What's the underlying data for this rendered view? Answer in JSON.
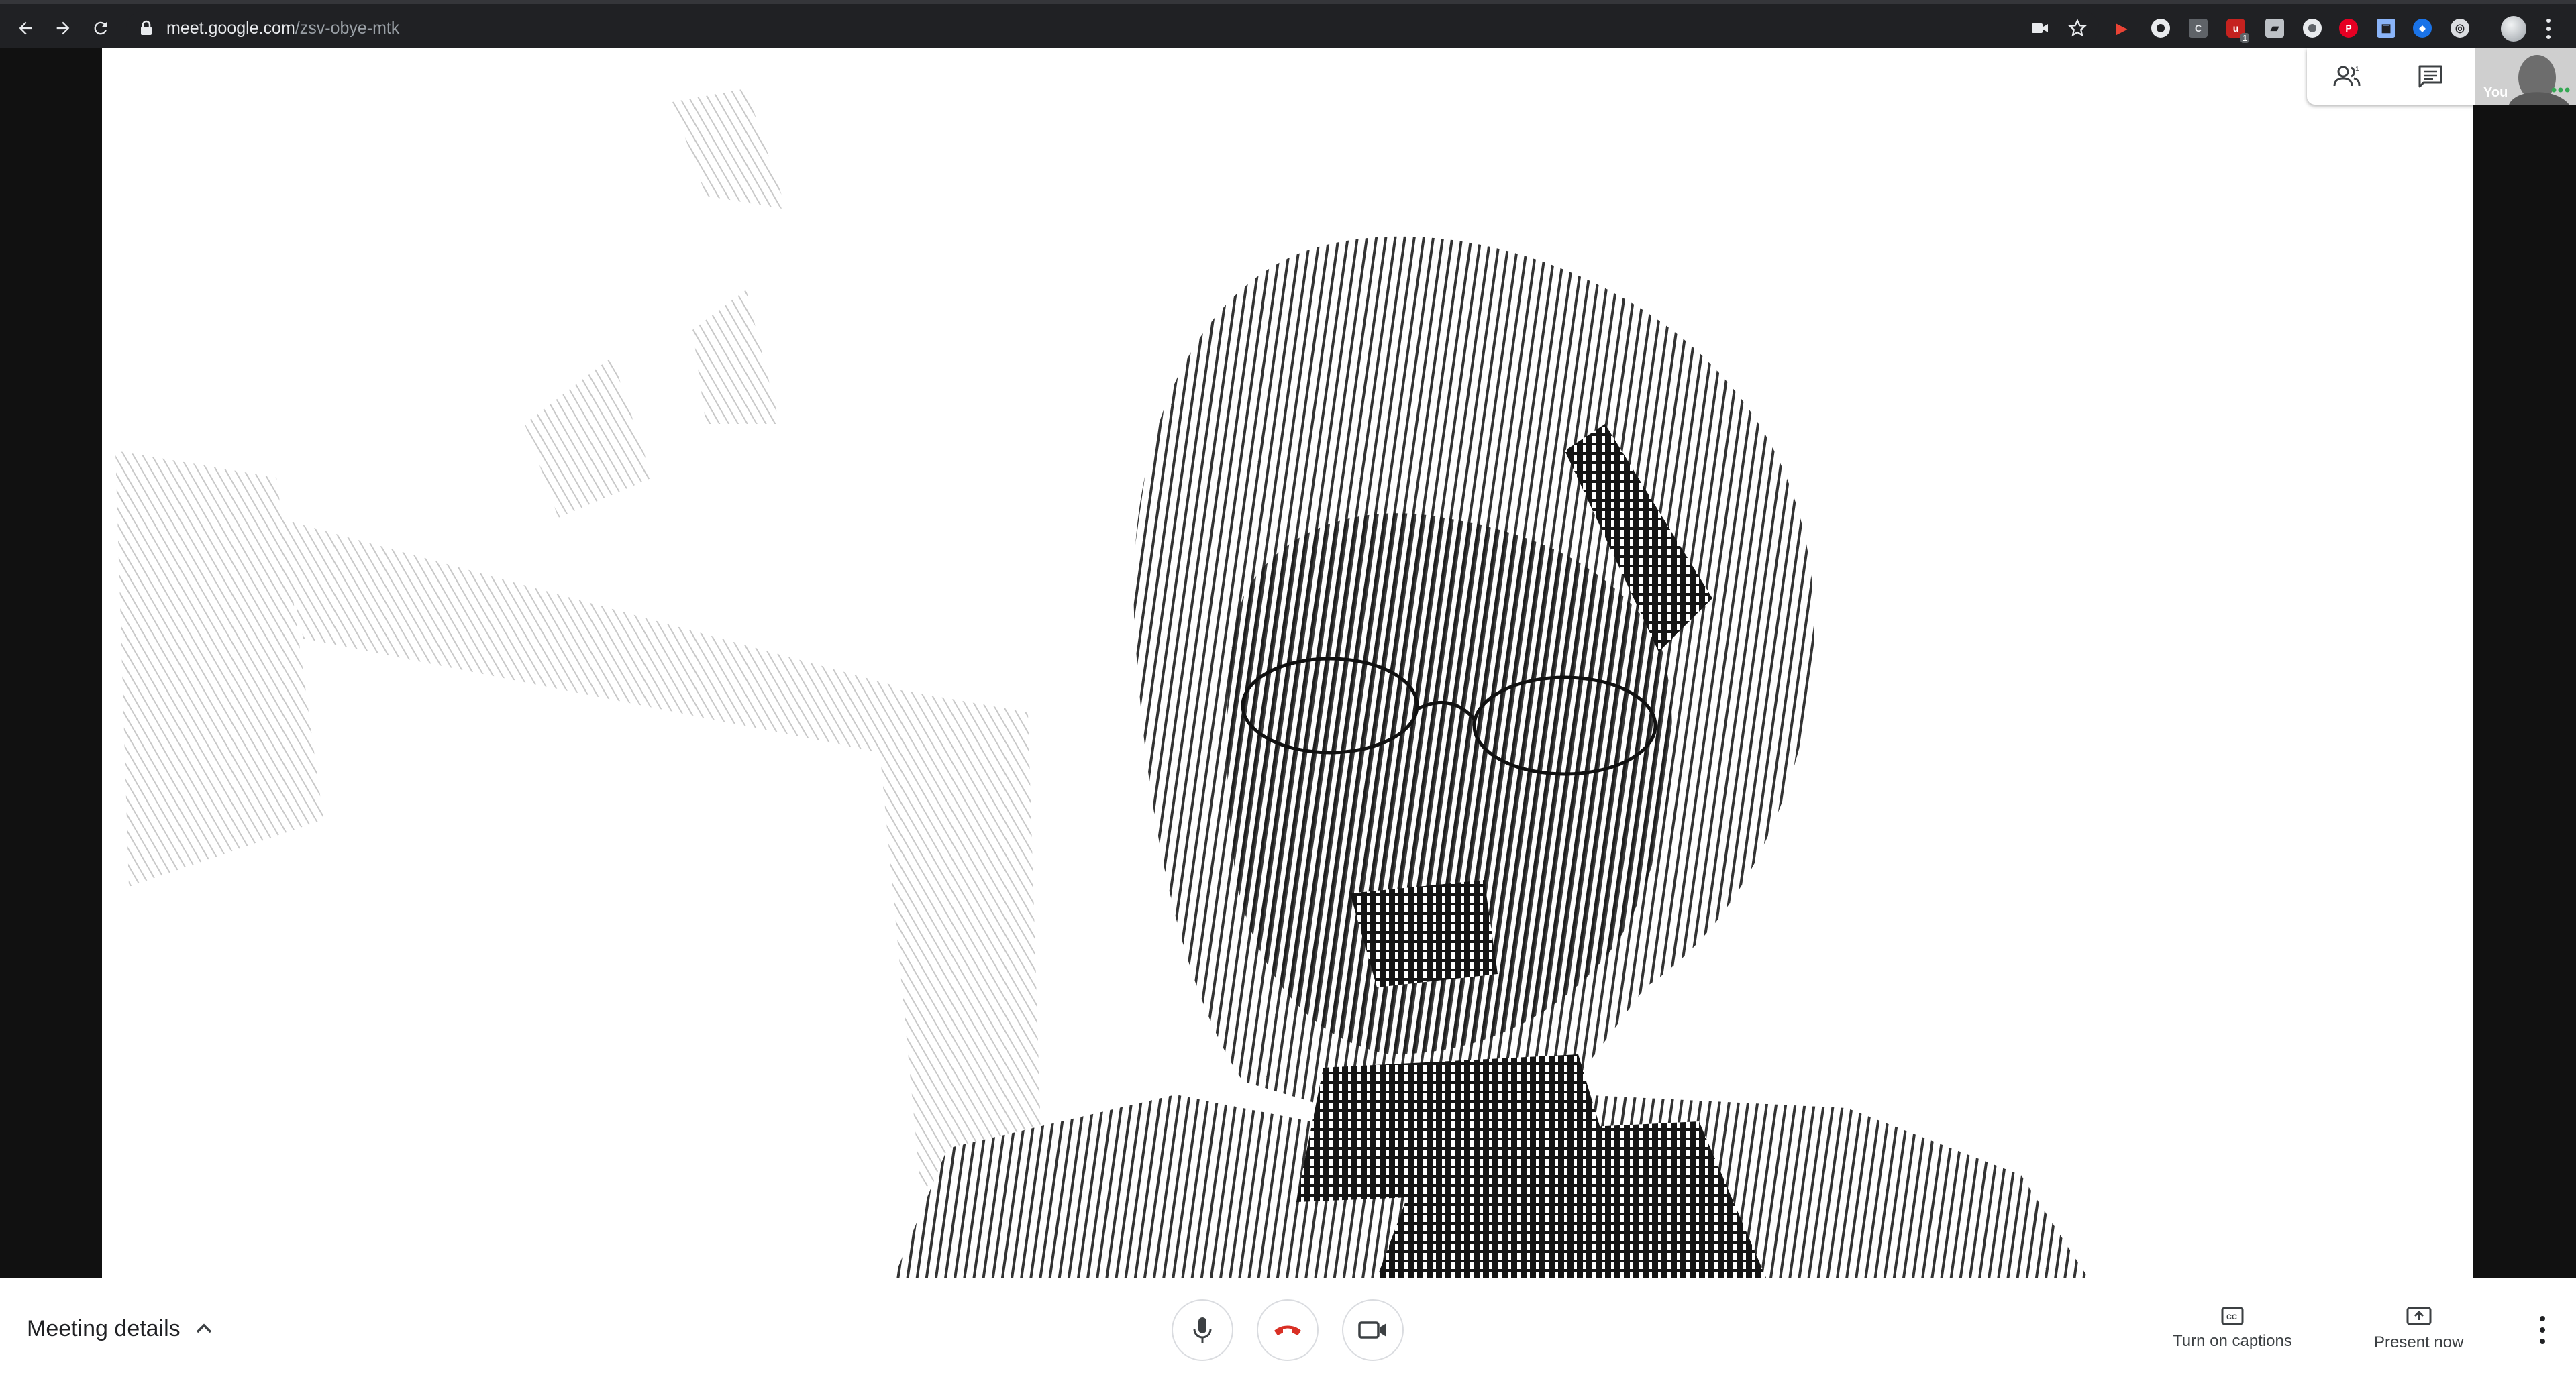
{
  "browser": {
    "url_domain": "meet.google.com",
    "url_path": "/zsv-obye-mtk",
    "extensions": [
      {
        "name": "video-ext-icon",
        "color": "#ea4335",
        "glyph": "▶"
      },
      {
        "name": "circle-ext-icon",
        "color": "#e8eaed",
        "glyph": "●"
      },
      {
        "name": "c-ext-icon",
        "color": "#9aa0a6",
        "glyph": "C"
      },
      {
        "name": "ublock-ext-icon",
        "color": "#c5221f",
        "glyph": "u"
      },
      {
        "name": "image-ext-icon",
        "color": "#bdc1c6",
        "glyph": "▰"
      },
      {
        "name": "grey-circle-ext-icon",
        "color": "#e8eaed",
        "glyph": "◉"
      },
      {
        "name": "pinterest-ext-icon",
        "color": "#e60023",
        "glyph": "P"
      },
      {
        "name": "screen-ext-icon",
        "color": "#8ab4f8",
        "glyph": "▣"
      },
      {
        "name": "blue-ext-icon",
        "color": "#1a73e8",
        "glyph": "◆"
      },
      {
        "name": "lens-ext-icon",
        "color": "#dadce0",
        "glyph": "◎"
      }
    ],
    "ublock_badge": "1"
  },
  "meet": {
    "self_label": "You",
    "meeting_details_label": "Meeting details",
    "captions_label": "Turn on captions",
    "present_label": "Present now"
  },
  "colors": {
    "hangup": "#d93025",
    "icon": "#5f6368"
  }
}
